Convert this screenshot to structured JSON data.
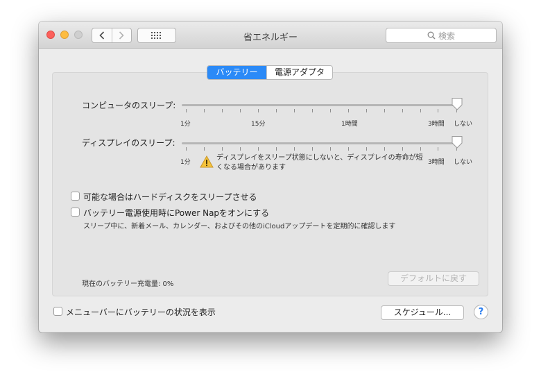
{
  "window": {
    "title": "省エネルギー"
  },
  "search": {
    "placeholder": "検索"
  },
  "tabs": [
    {
      "label": "バッテリー",
      "active": true
    },
    {
      "label": "電源アダプタ",
      "active": false
    }
  ],
  "computer_sleep": {
    "label": "コンピュータのスリープ:",
    "value": "しない",
    "tick_labels": [
      "1分",
      "15分",
      "1時間",
      "3時間",
      "しない"
    ]
  },
  "display_sleep": {
    "label": "ディスプレイのスリープ:",
    "value": "しない",
    "tick_labels": [
      "1分",
      "3時間",
      "しない"
    ],
    "warning": "ディスプレイをスリープ状態にしないと、ディスプレイの寿命が短くなる場合があります"
  },
  "options": [
    {
      "label": "可能な場合はハードディスクをスリープさせる",
      "checked": false
    },
    {
      "label": "バッテリー電源使用時にPower Napをオンにする",
      "checked": false,
      "description": "スリープ中に、新着メール、カレンダー、およびその他のiCloudアップデートを定期的に確認します"
    }
  ],
  "battery_status": "現在のバッテリー充電量: 0%",
  "restore_defaults": "デフォルトに戻す",
  "menubar_option": {
    "label": "メニューバーにバッテリーの状況を表示",
    "checked": false
  },
  "schedule_button": "スケジュール...",
  "help_button": "?",
  "colors": {
    "accent": "#2b8af7",
    "close": "#fc605c",
    "minimize": "#fdbc40"
  }
}
